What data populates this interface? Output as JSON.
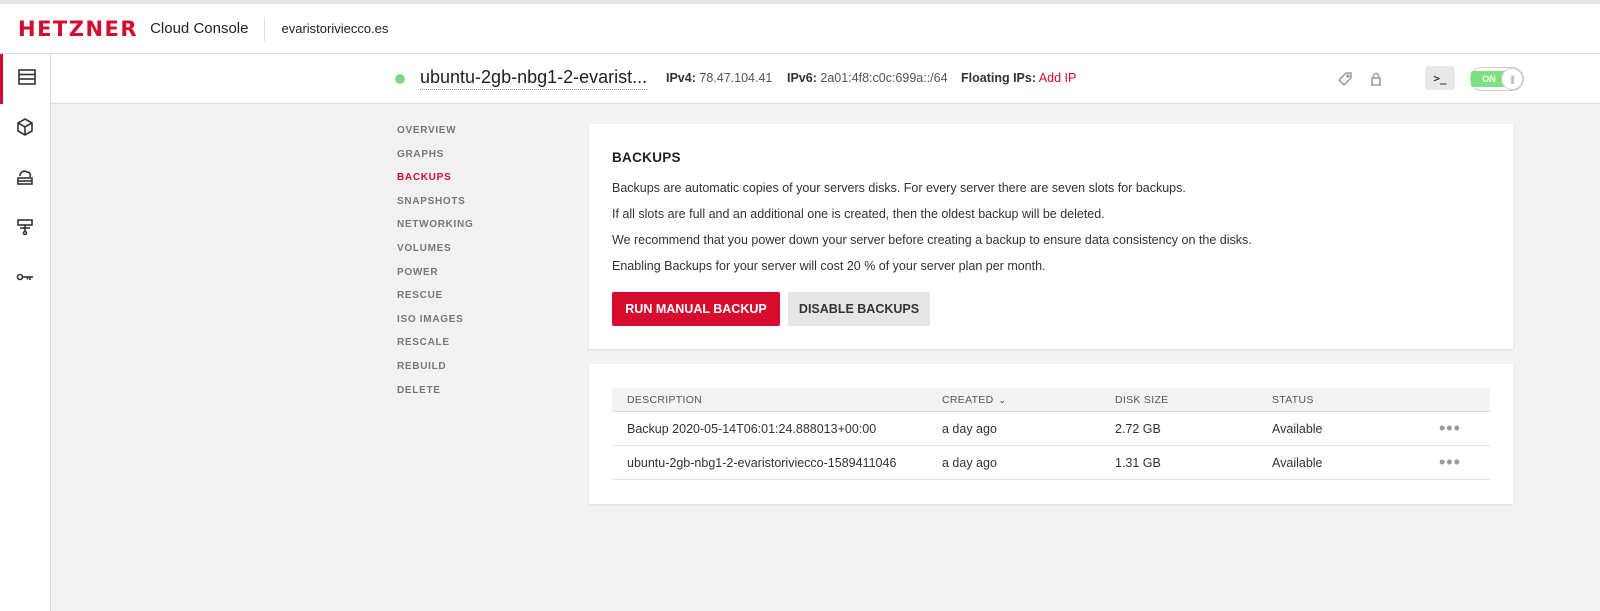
{
  "header": {
    "logo": "HETZNER",
    "console_label": "Cloud Console",
    "project": "evaristoriviecco.es"
  },
  "server": {
    "name": "ubuntu-2gb-nbg1-2-evarist...",
    "status_color": "#7fd87f",
    "ipv4_label": "IPv4:",
    "ipv4": "78.47.104.41",
    "ipv6_label": "IPv6:",
    "ipv6": "2a01:4f8:c0c:699a::/64",
    "floating_label": "Floating IPs:",
    "floating_action": "Add IP",
    "console_glyph": ">_",
    "power_state": "ON",
    "power_knob": "|||"
  },
  "rail": {
    "icons": [
      "servers-icon",
      "cube-icon",
      "cloud-drive-icon",
      "network-icon",
      "key-icon"
    ]
  },
  "subnav": {
    "items": [
      "OVERVIEW",
      "GRAPHS",
      "BACKUPS",
      "SNAPSHOTS",
      "NETWORKING",
      "VOLUMES",
      "POWER",
      "RESCUE",
      "ISO IMAGES",
      "RESCALE",
      "REBUILD",
      "DELETE"
    ],
    "active": "BACKUPS"
  },
  "backups": {
    "title": "BACKUPS",
    "paragraphs": [
      "Backups are automatic copies of your servers disks. For every server there are seven slots for backups.",
      "If all slots are full and an additional one is created, then the oldest backup will be deleted.",
      "We recommend that you power down your server before creating a backup to ensure data consistency on the disks.",
      "Enabling Backups for your server will cost 20 % of your server plan per month."
    ],
    "run_button": "RUN MANUAL BACKUP",
    "disable_button": "DISABLE BACKUPS"
  },
  "table": {
    "columns": [
      "DESCRIPTION",
      "CREATED",
      "DISK SIZE",
      "STATUS"
    ],
    "sort_indicator": "⌄",
    "rows": [
      {
        "description": "Backup 2020-05-14T06:01:24.888013+00:00",
        "created": "a day ago",
        "size": "2.72 GB",
        "status": "Available",
        "menu": "•••"
      },
      {
        "description": "ubuntu-2gb-nbg1-2-evaristoriviecco-1589411046",
        "created": "a day ago",
        "size": "1.31 GB",
        "status": "Available",
        "menu": "•••"
      }
    ]
  },
  "colors": {
    "brand": "#d50c2d",
    "status_on": "#7fd87f",
    "background": "#f2f2f2"
  }
}
